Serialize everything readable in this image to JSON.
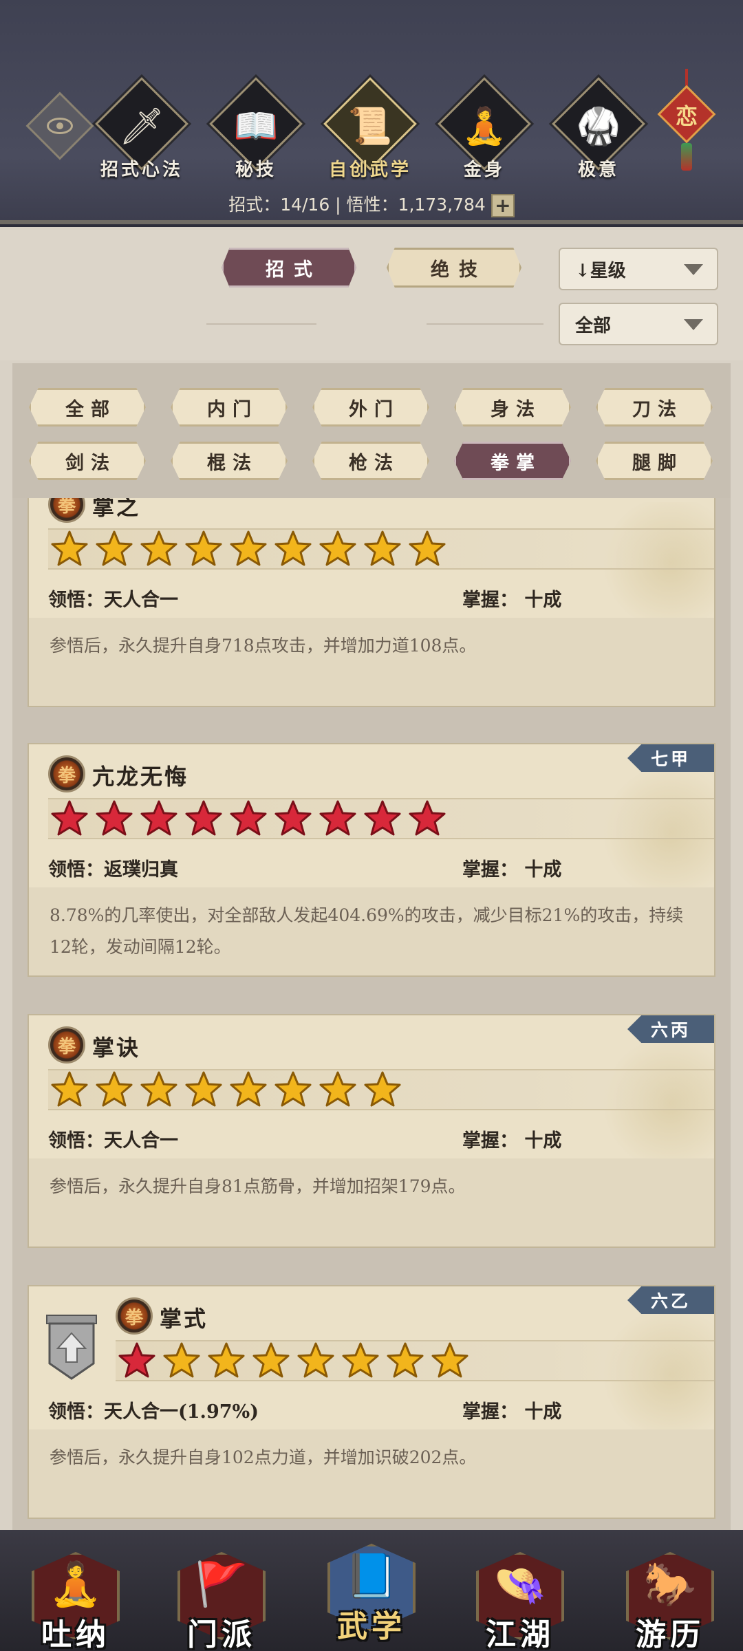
{
  "header": {
    "nav": [
      {
        "label": "招式心法",
        "icon": "sword-icon",
        "glyph": "🗡"
      },
      {
        "label": "秘技",
        "icon": "book-icon",
        "glyph": "📖"
      },
      {
        "label": "自创武学",
        "icon": "scroll-icon",
        "glyph": "📜"
      },
      {
        "label": "金身",
        "icon": "meditation-icon",
        "glyph": "🧘"
      },
      {
        "label": "极意",
        "icon": "martial-stance-icon",
        "glyph": "🥋"
      }
    ],
    "active_nav": 2,
    "knot_char": "恋",
    "stats": "招式：14/16 | 悟性：1,173,784",
    "plus": "+"
  },
  "controls": {
    "tabs": [
      "招式",
      "绝技"
    ],
    "active_tab": 0,
    "sort_label": "↓星级",
    "filter_label": "全部"
  },
  "filters": {
    "items": [
      "全部",
      "内门",
      "外门",
      "身法",
      "刀法",
      "剑法",
      "棍法",
      "枪法",
      "拳掌",
      "腿脚"
    ],
    "active": 8
  },
  "cards": [
    {
      "title": "掌之",
      "rank": "",
      "stars": [
        "gold",
        "gold",
        "gold",
        "gold",
        "gold",
        "gold",
        "gold",
        "gold",
        "gold"
      ],
      "comprehension": "领悟：天人合一",
      "mastery": "掌握：  十成",
      "desc": "参悟后，永久提升自身718点攻击，并增加力道108点。"
    },
    {
      "title": "亢龙无悔",
      "rank": "七甲",
      "stars": [
        "red",
        "red",
        "red",
        "red",
        "red",
        "red",
        "red",
        "red",
        "red"
      ],
      "comprehension": "领悟：返璞归真",
      "mastery": "掌握：  十成",
      "desc": "8.78%的几率使出，对全部敌人发起404.69%的攻击，减少目标21%的攻击，持续12轮，发动间隔12轮。"
    },
    {
      "title": "掌诀",
      "rank": "六丙",
      "stars": [
        "gold",
        "gold",
        "gold",
        "gold",
        "gold",
        "gold",
        "gold",
        "gold"
      ],
      "comprehension": "领悟：天人合一",
      "mastery": "掌握：  十成",
      "desc": "参悟后，永久提升自身81点筋骨，并增加招架179点。"
    },
    {
      "title": "掌式",
      "rank": "六乙",
      "stars": [
        "red",
        "gold",
        "gold",
        "gold",
        "gold",
        "gold",
        "gold",
        "gold"
      ],
      "comprehension": "领悟：天人合一(1.97%)",
      "mastery": "掌握：  十成",
      "desc": "参悟后，永久提升自身102点力道，并增加识破202点。"
    }
  ],
  "bottom_nav": [
    {
      "label": "吐纳",
      "icon": "monk-icon",
      "glyph": "🧘"
    },
    {
      "label": "门派",
      "icon": "sect-flags-icon",
      "glyph": "🚩"
    },
    {
      "label": "武学",
      "icon": "martial-book-icon",
      "glyph": "📘"
    },
    {
      "label": "江湖",
      "icon": "straw-hat-icon",
      "glyph": "👒"
    },
    {
      "label": "游历",
      "icon": "horse-icon",
      "glyph": "🐎"
    }
  ],
  "bottom_active": 2,
  "colors": {
    "accent": "#6f4b55",
    "rank_badge": "#4b5f78",
    "gold_star": "#f2b51c",
    "red_star": "#d8283a"
  }
}
